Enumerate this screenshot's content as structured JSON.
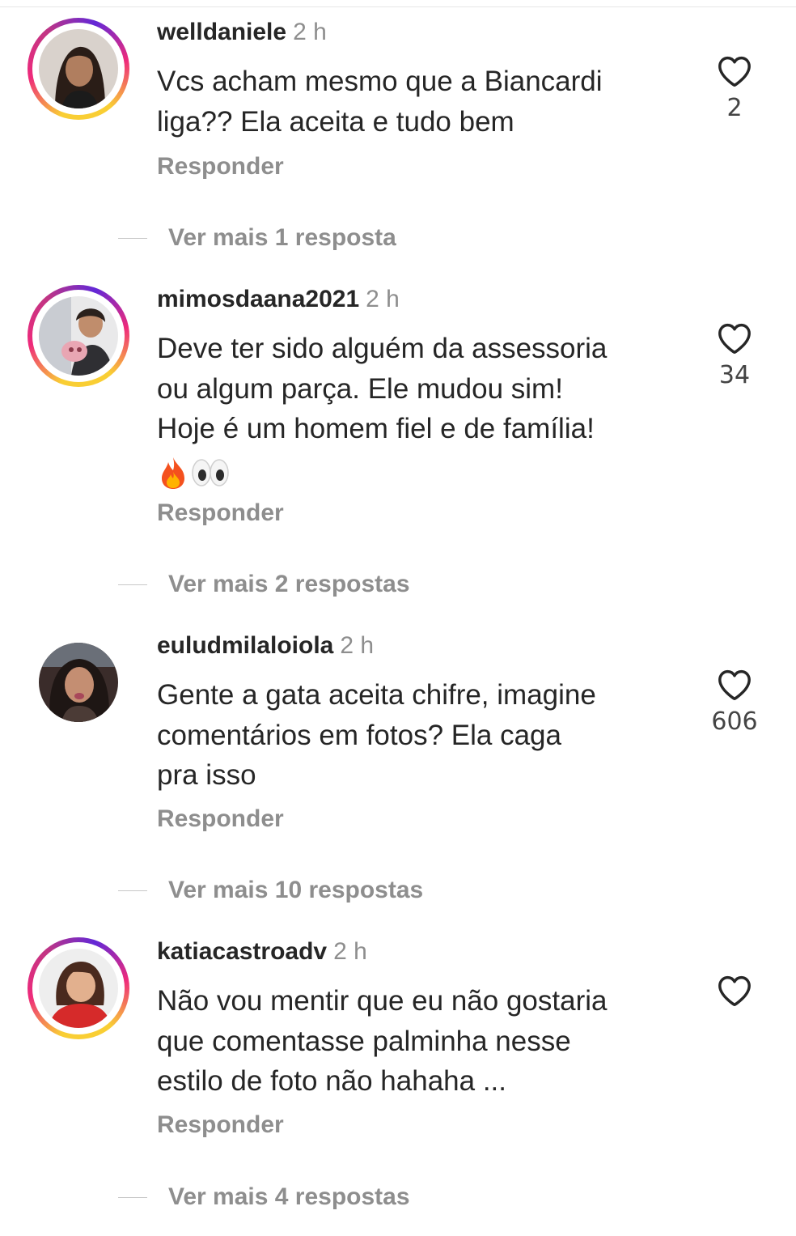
{
  "comments": [
    {
      "username": "welldaniele",
      "time": "2 h",
      "lines": [
        "Vcs acham mesmo que a Biancardi",
        "liga?? Ela aceita e tudo bem"
      ],
      "likes": "2",
      "reply_label": "Responder",
      "more_replies": "Ver mais 1 resposta",
      "avatar_ring": true
    },
    {
      "username": "mimosdaana2021",
      "time": "2 h",
      "lines": [
        "Deve ter sido alguém da assessoria",
        "ou algum parça. Ele mudou sim!",
        "Hoje é um homem fiel e de família!"
      ],
      "emojis": [
        "fire-emoji",
        "eyes-emoji"
      ],
      "likes": "34",
      "reply_label": "Responder",
      "more_replies": "Ver mais 2 respostas",
      "avatar_ring": true
    },
    {
      "username": "euludmilaloiola",
      "time": "2 h",
      "lines": [
        "Gente a gata aceita chifre, imagine",
        "comentários em fotos? Ela caga",
        "pra isso"
      ],
      "likes": "606",
      "reply_label": "Responder",
      "more_replies": "Ver mais 10 respostas",
      "avatar_ring": false
    },
    {
      "username": "katiacastroadv",
      "time": "2 h",
      "lines": [
        "Não vou mentir que eu não gostaria",
        "que comentasse palminha nesse",
        "estilo de foto não hahaha ..."
      ],
      "likes": "",
      "reply_label": "Responder",
      "more_replies": "Ver mais 4 respostas",
      "avatar_ring": true
    }
  ],
  "icons": {
    "like": "heart-outline-icon"
  },
  "colors": {
    "text": "#262626",
    "secondary": "#8e8e8e",
    "story_ring": [
      "#f9ce34",
      "#ee2a7b",
      "#6228d7"
    ]
  }
}
